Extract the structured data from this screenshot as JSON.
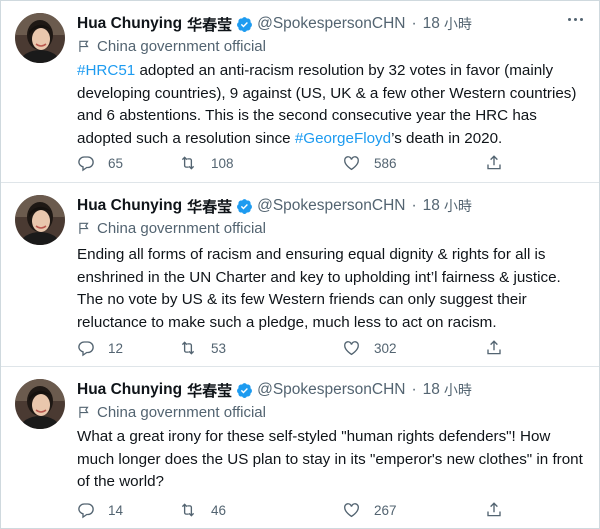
{
  "colors": {
    "link": "#1d9bf0",
    "muted": "#536471",
    "verified": "#1d9bf0",
    "text": "#0f1419"
  },
  "icons": [
    "avatar",
    "verified-badge-icon",
    "flag-icon",
    "more-icon",
    "reply-icon",
    "retweet-icon",
    "like-icon",
    "share-icon"
  ],
  "tweets": [
    {
      "name": "Hua Chunying",
      "name_cjk": "华春莹",
      "handle": "@SpokespersonCHN",
      "dot": "·",
      "time": "18",
      "time_unit": "小時",
      "label": "China government official",
      "lines": [
        [
          {
            "t": "#HRC51",
            "link": true
          },
          {
            "t": " adopted an anti-racism resolution by 32 votes in favor (mainly"
          }
        ],
        [
          {
            "t": "developing countries), 9 against (US, UK & a few other Western countries)"
          }
        ],
        [
          {
            "t": "and 6 abstentions. This is the second consecutive year the HRC has"
          }
        ],
        [
          {
            "t": "adopted such a resolution since "
          },
          {
            "t": "#GeorgeFloyd",
            "link": true
          },
          {
            "t": "’s death in 2020."
          }
        ]
      ],
      "replies": "65",
      "retweets": "108",
      "likes": "586"
    },
    {
      "name": "Hua Chunying",
      "name_cjk": "华春莹",
      "handle": "@SpokespersonCHN",
      "dot": "·",
      "time": "18",
      "time_unit": "小時",
      "label": "China government official",
      "lines": [
        [
          {
            "t": "Ending all forms of racism and ensuring equal dignity & rights for all is"
          }
        ],
        [
          {
            "t": "enshrined in the UN Charter and key to upholding int’l fairness & justice."
          }
        ],
        [
          {
            "t": "The no vote by US & its few Western friends can only suggest their"
          }
        ],
        [
          {
            "t": "reluctance to make such a pledge, much less to act on racism."
          }
        ]
      ],
      "replies": "12",
      "retweets": "53",
      "likes": "302"
    },
    {
      "name": "Hua Chunying",
      "name_cjk": "华春莹",
      "handle": "@SpokespersonCHN",
      "dot": "·",
      "time": "18",
      "time_unit": "小時",
      "label": "China government official",
      "lines": [
        [
          {
            "t": "What a great irony for these self-styled \"human rights defenders\"! How"
          }
        ],
        [
          {
            "t": "much longer does the US plan to stay in its \"emperor's new clothes\" in front"
          }
        ],
        [
          {
            "t": "of the world?"
          }
        ]
      ],
      "replies": "14",
      "retweets": "46",
      "likes": "267"
    }
  ]
}
